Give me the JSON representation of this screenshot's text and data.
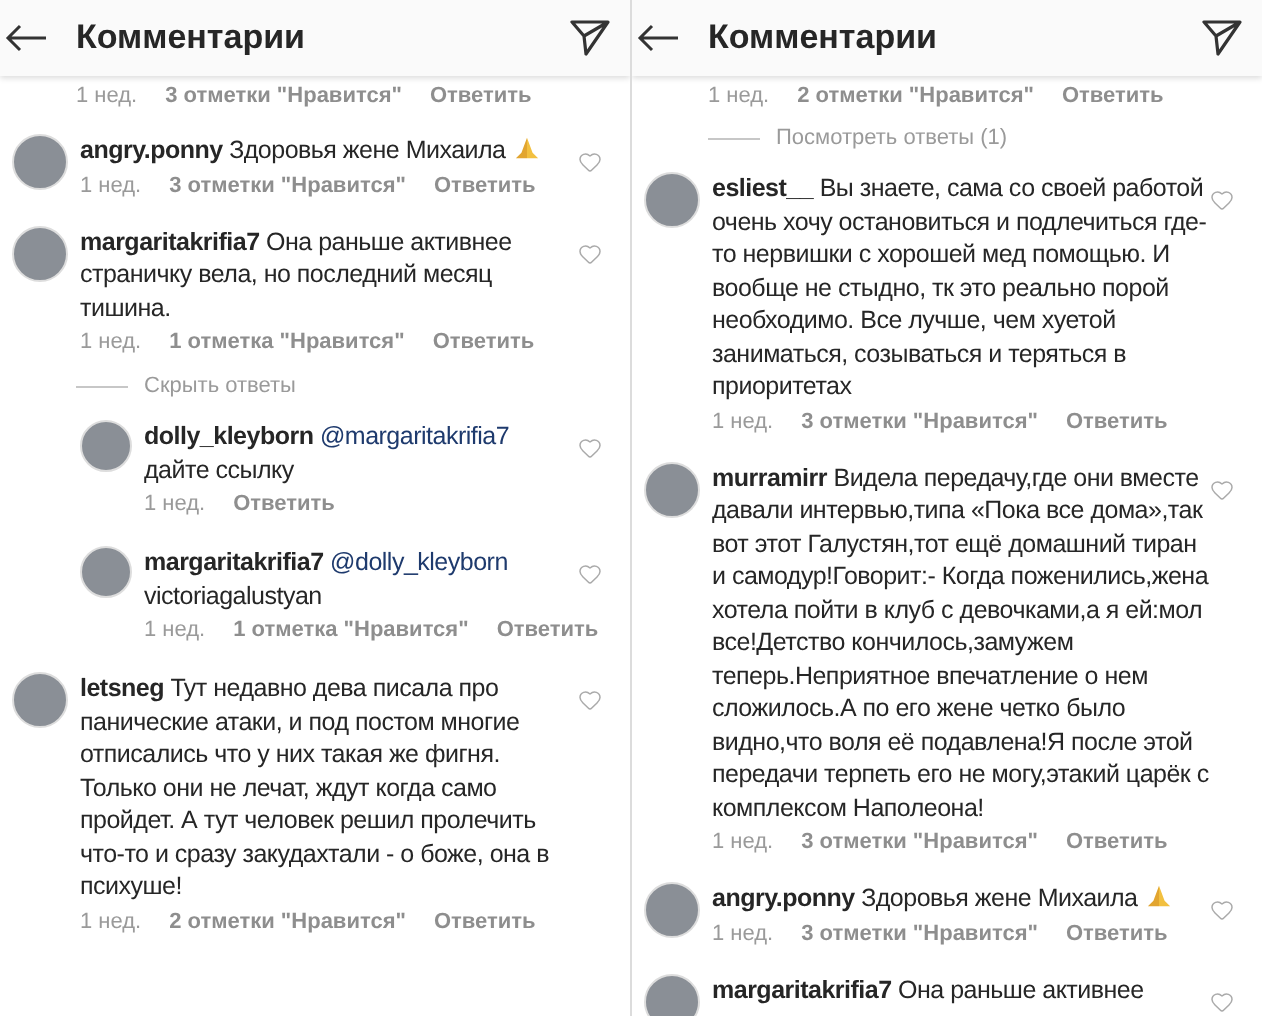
{
  "panels": [
    {
      "title": "Комментарии",
      "items": [
        {
          "kind": "meta",
          "time": "1 нед.",
          "likes": "3 отметки \"Нравится\"",
          "reply": "Ответить"
        },
        {
          "kind": "comment",
          "user": "angry.ponny",
          "text": "Здоровья жене Михаила",
          "praying_hands": true,
          "meta": {
            "time": "1 нед.",
            "likes": "3 отметки \"Нравится\"",
            "reply": "Ответить"
          }
        },
        {
          "kind": "comment",
          "user": "margaritakrifia7",
          "text": "Она раньше активнее страничку вела,  но последний месяц тишина.",
          "meta": {
            "time": "1 нед.",
            "likes": "1 отметка \"Нравится\"",
            "reply": "Ответить"
          }
        },
        {
          "kind": "toggle",
          "label": "Скрыть ответы"
        },
        {
          "kind": "reply",
          "user": "dolly_kleyborn",
          "mention": "@margaritakrifia7",
          "text": "дайте ссылку",
          "meta": {
            "time": "1 нед.",
            "reply": "Ответить"
          }
        },
        {
          "kind": "reply",
          "user": "margaritakrifia7",
          "mention": "@dolly_kleyborn",
          "text": "victoriagalustyan",
          "meta": {
            "time": "1 нед.",
            "likes": "1 отметка \"Нравится\"",
            "reply": "Ответить"
          }
        },
        {
          "kind": "comment",
          "user": "letsneg",
          "text": "Тут недавно дева писала про панические атаки, и под постом многие отписались что у них такая же фигня. Только они не лечат, ждут когда само пройдет. А тут человек решил пролечить что-то и сразу закудахтали - о боже, она в психуше!",
          "meta": {
            "time": "1 нед.",
            "likes": "2 отметки \"Нравится\"",
            "reply": "Ответить"
          }
        }
      ]
    },
    {
      "title": "Комментарии",
      "items": [
        {
          "kind": "meta",
          "time": "1 нед.",
          "likes": "2 отметки \"Нравится\"",
          "reply": "Ответить"
        },
        {
          "kind": "toggle",
          "label": "Посмотреть ответы (1)"
        },
        {
          "kind": "comment",
          "user": "esliest__",
          "text": "Вы знаете, сама со своей работой очень хочу остановиться и подлечиться где-то нервишки с хорошей мед помощью. И вообще не стыдно, тк это реально порой необходимо. Все лучше, чем хуетой заниматься, созываться и теряться в приоритетах",
          "meta": {
            "time": "1 нед.",
            "likes": "3 отметки \"Нравится\"",
            "reply": "Ответить"
          }
        },
        {
          "kind": "comment",
          "user": "murramirr",
          "text": "Видела передачу,где они вместе давали интервью,типа «Пока все дома»,так вот этот Галустян,тот ещё домашний тиран и самодур!Говорит:- Когда поженились,жена хотела пойти в клуб с девочками,а я ей:мол все!Детство кончилось,замужем теперь.Неприятное впечатление о нем сложилось.А по его жене четко было видно,что воля её подавлена!Я после этой передачи терпеть его не могу,этакий царёк с комплексом Наполеона!",
          "meta": {
            "time": "1 нед.",
            "likes": "3 отметки \"Нравится\"",
            "reply": "Ответить"
          }
        },
        {
          "kind": "comment",
          "user": "angry.ponny",
          "text": "Здоровья жене Михаила",
          "praying_hands": true,
          "meta": {
            "time": "1 нед.",
            "likes": "3 отметки \"Нравится\"",
            "reply": "Ответить"
          }
        },
        {
          "kind": "comment",
          "user": "margaritakrifia7",
          "text": "Она раньше активнее"
        }
      ]
    }
  ]
}
